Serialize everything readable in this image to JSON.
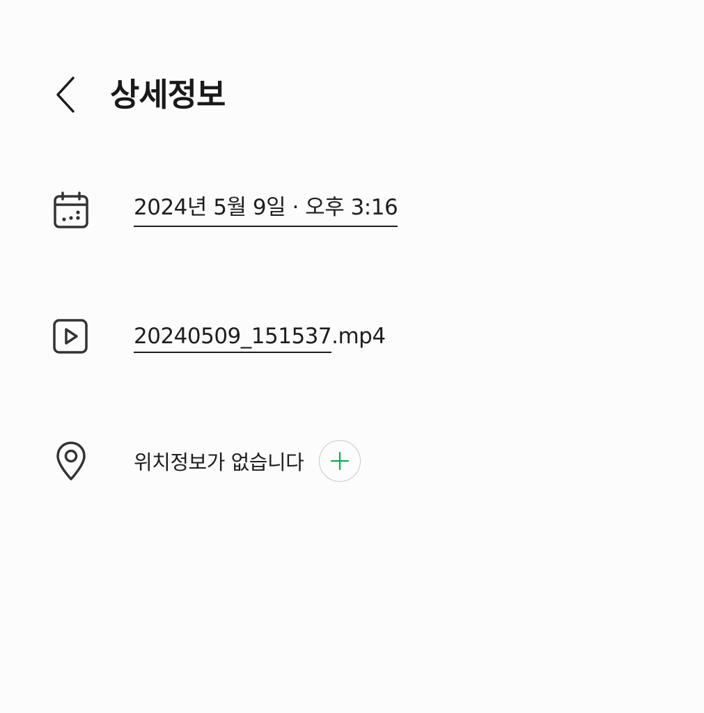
{
  "header": {
    "title": "상세정보",
    "back_icon": "chevron-left-icon"
  },
  "details": {
    "date_time": "2024년 5월 9일 · 오후 3:16",
    "date_icon": "calendar-icon",
    "file_stem": "20240509_151537",
    "file_ext": ".mp4",
    "file_icon": "video-file-icon",
    "location_text": "위치정보가 없습니다",
    "location_icon": "location-pin-icon",
    "add_location_icon": "plus-icon"
  },
  "colors": {
    "background": "#fcfcfc",
    "text": "#1e1e1e",
    "accent": "#1aa35a",
    "button_border": "#c8c8c8"
  }
}
